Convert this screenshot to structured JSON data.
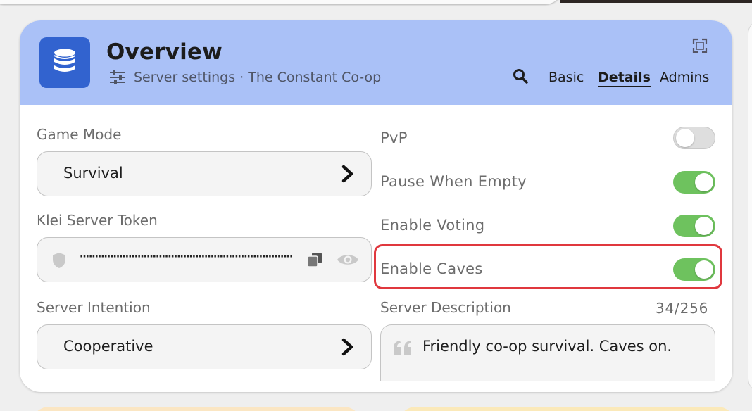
{
  "header": {
    "title": "Overview",
    "subtitle": "Server settings · The Constant Co-op",
    "tabs": [
      {
        "label": "Basic",
        "active": false
      },
      {
        "label": "Details",
        "active": true
      },
      {
        "label": "Admins",
        "active": false
      }
    ],
    "icons": {
      "app": "database-icon",
      "subtitle": "sliders-icon",
      "search": "search-icon",
      "expand": "expand-icon"
    }
  },
  "left": {
    "game_mode": {
      "label": "Game Mode",
      "value": "Survival"
    },
    "token": {
      "label": "Klei Server Token",
      "masked_value": "······································································"
    },
    "intention": {
      "label": "Server Intention",
      "value": "Cooperative"
    }
  },
  "right": {
    "toggles": [
      {
        "label": "PvP",
        "on": false
      },
      {
        "label": "Pause When Empty",
        "on": true
      },
      {
        "label": "Enable Voting",
        "on": true
      },
      {
        "label": "Enable Caves",
        "on": true,
        "highlighted": true
      }
    ],
    "description": {
      "label": "Server Description",
      "counter": "34/256",
      "value": "Friendly co-op survival. Caves on."
    }
  },
  "colors": {
    "header_bg": "#aac1f7",
    "app_icon_bg": "#3263cf",
    "toggle_on": "#6ec25e",
    "toggle_off": "#dedede",
    "highlight": "#e0383e"
  }
}
